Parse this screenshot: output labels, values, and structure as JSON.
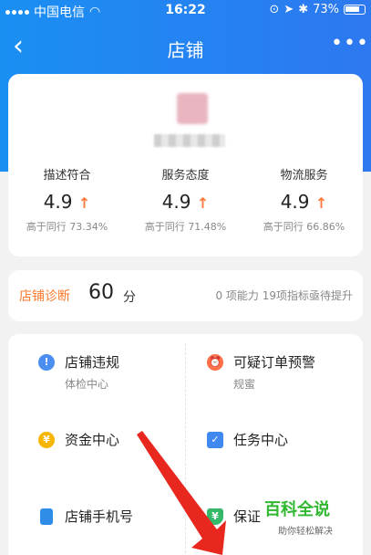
{
  "status_bar": {
    "carrier": "中国电信",
    "time": "16:22",
    "battery": "73%"
  },
  "nav": {
    "back_icon": "chevron-left-icon",
    "title": "店铺",
    "more_icon": "more-dots-icon"
  },
  "shop": {
    "metrics": [
      {
        "label": "描述符合",
        "value": "4.9",
        "trend": "↑",
        "compare": "高于同行 73.34%"
      },
      {
        "label": "服务态度",
        "value": "4.9",
        "trend": "↑",
        "compare": "高于同行 71.48%"
      },
      {
        "label": "物流服务",
        "value": "4.9",
        "trend": "↑",
        "compare": "高于同行 66.86%"
      }
    ]
  },
  "diagnosis": {
    "label": "店铺诊断",
    "score": "60",
    "unit": "分",
    "description": "0 项能力 19项指标亟待提升"
  },
  "tools": [
    {
      "title": "店铺违规",
      "subtitle": "体检中心",
      "icon": "info-icon",
      "glyph": "!"
    },
    {
      "title": "可疑订单预警",
      "subtitle": "规蜜",
      "icon": "alarm-clock-icon",
      "glyph": "⏰"
    },
    {
      "title": "资金中心",
      "subtitle": "",
      "icon": "coin-icon",
      "glyph": "¥"
    },
    {
      "title": "任务中心",
      "subtitle": "",
      "icon": "clipboard-check-icon",
      "glyph": "✓"
    },
    {
      "title": "店铺手机号",
      "subtitle": "",
      "icon": "phone-icon",
      "glyph": ""
    },
    {
      "title": "保证",
      "subtitle": "",
      "icon": "shield-icon",
      "glyph": "¥"
    }
  ],
  "watermark": {
    "title": "百科全说",
    "subtitle": "助你轻松解决"
  },
  "colors": {
    "header_blue": "#1a8ff2",
    "accent_orange": "#ff7a2d",
    "arrow_red": "#e8271f",
    "watermark_green": "#2fb82f"
  }
}
